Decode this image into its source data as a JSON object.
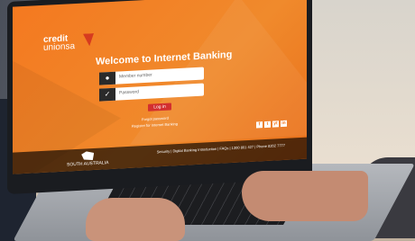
{
  "brand": {
    "line1": "credit",
    "line2": "unionsa"
  },
  "welcome_title": "Welcome to Internet Banking",
  "login_form": {
    "member_placeholder": "Member number",
    "password_placeholder": "Password",
    "login_button": "Log in",
    "link_forgot": "Forgot password",
    "link_register": "Register for Internet Banking"
  },
  "social": [
    "f",
    "t",
    "yt",
    "in"
  ],
  "footer": {
    "logo_text": "SOUTH AUSTRALIA",
    "links": "Security | Digital Banking Introduction | FAQs | 1300 801 427 | Phone 8202 7777"
  },
  "colors": {
    "primary": "#f47920",
    "button": "#d32f2f"
  }
}
